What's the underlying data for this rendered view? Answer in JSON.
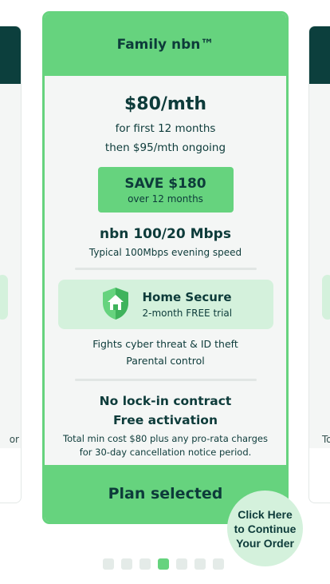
{
  "peek_left": {
    "text": "or"
  },
  "peek_right": {
    "text": "To"
  },
  "plan": {
    "title": "Family nbn™",
    "price": "$80/mth",
    "price_note_1": "for first 12 months",
    "price_note_2": "then $95/mth ongoing",
    "save": {
      "title": "SAVE $180",
      "sub": "over 12 months"
    },
    "speed": "nbn 100/20 Mbps",
    "speed_note": "Typical 100Mbps evening speed",
    "home_secure": {
      "icon": "house-shield-icon",
      "title": "Home Secure",
      "sub": "2-month FREE trial"
    },
    "features": [
      "Fights cyber threat & ID theft",
      "Parental control"
    ],
    "contract_1": "No lock-in contract",
    "contract_2": "Free activation",
    "fine_1": "Total min cost $80 plus any pro-rata charges",
    "fine_2": "for 30-day cancellation notice period.",
    "selected_label": "Plan selected"
  },
  "cta": {
    "line1": "Click Here",
    "line2": "to Continue",
    "line3": "Your Order"
  },
  "pagination": {
    "count": 7,
    "active_index": 3
  },
  "colors": {
    "accent_green": "#66d37e",
    "light_green": "#d4f1dc",
    "dark_teal": "#0c3f3d",
    "card_bg": "#f4f6f5"
  }
}
